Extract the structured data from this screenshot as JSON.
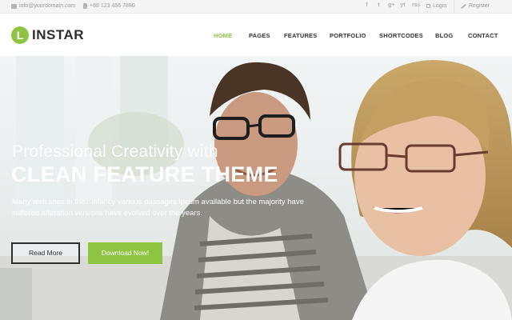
{
  "topbar": {
    "email": "info@yourdomain.com",
    "phone": "+88 123 456 7890",
    "social": [
      "f",
      "t",
      "g+",
      "yt",
      "rss"
    ],
    "login": "Login",
    "register": "Register"
  },
  "header": {
    "logo_letter": "L",
    "logo_text": "INSTAR",
    "nav": [
      "HOME",
      "PAGES",
      "FEATURES",
      "PORTFOLIO",
      "SHORTCODES",
      "BLOG",
      "CONTACT"
    ],
    "active_nav": "HOME"
  },
  "hero": {
    "line1": "Professional Creativity with",
    "line2": "CLEAN FEATURE THEME",
    "description": "Many web sites in their infancy various passages ipsum available but the majority have suffered alteration versions have evolved over the years.",
    "read_more": "Read More",
    "download": "Download Now!"
  },
  "colors": {
    "accent": "#8ec442",
    "dark": "#2d2d2d",
    "topbar_bg": "#f5f5f5"
  }
}
